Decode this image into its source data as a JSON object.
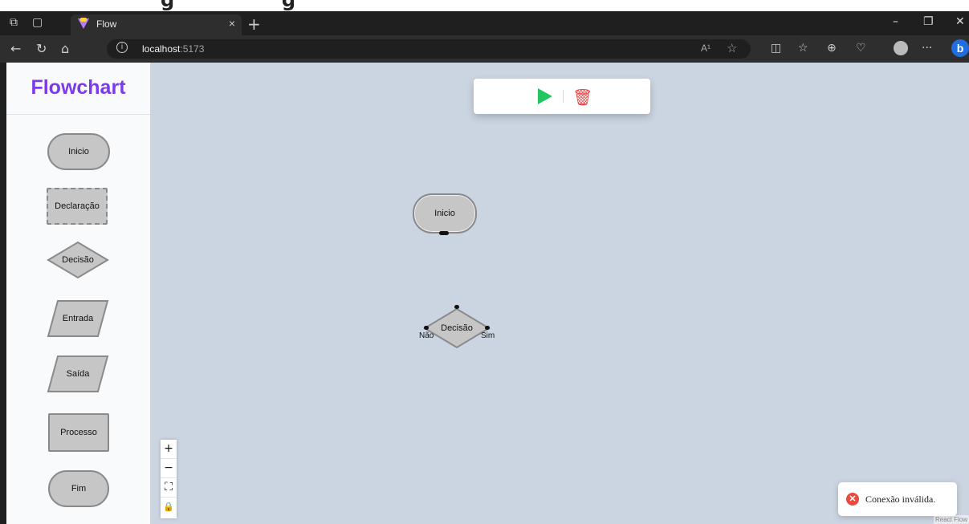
{
  "browser": {
    "tab_title": "Flow",
    "close_tab": "×",
    "new_tab": "+",
    "url_host": "localhost",
    "url_port": ":5173",
    "read_aloud": "A¹",
    "more": "···"
  },
  "sidebar": {
    "brand": "Flowchart",
    "brand_color": "#7c3aed",
    "items": [
      {
        "label": "Inicio"
      },
      {
        "label": "Declaração"
      },
      {
        "label": "Decisão"
      },
      {
        "label": "Entrada"
      },
      {
        "label": "Saída"
      },
      {
        "label": "Processo"
      },
      {
        "label": "Fim"
      }
    ]
  },
  "toolbar": {
    "run_icon": "play-icon",
    "delete_icon": "trash-icon",
    "run_color": "#22c55e",
    "delete_color": "#ef4444"
  },
  "canvas": {
    "nodes": {
      "start_label": "Inicio",
      "decision_label": "Decisão",
      "decision_no": "Não",
      "decision_yes": "Sim"
    },
    "controls": {
      "zoom_in": "+",
      "zoom_out": "−",
      "fit": "⛶",
      "lock": "🔒"
    },
    "toast": {
      "message": "Conexão inválida.",
      "icon": "error-icon"
    },
    "attribution": "React Flow"
  }
}
